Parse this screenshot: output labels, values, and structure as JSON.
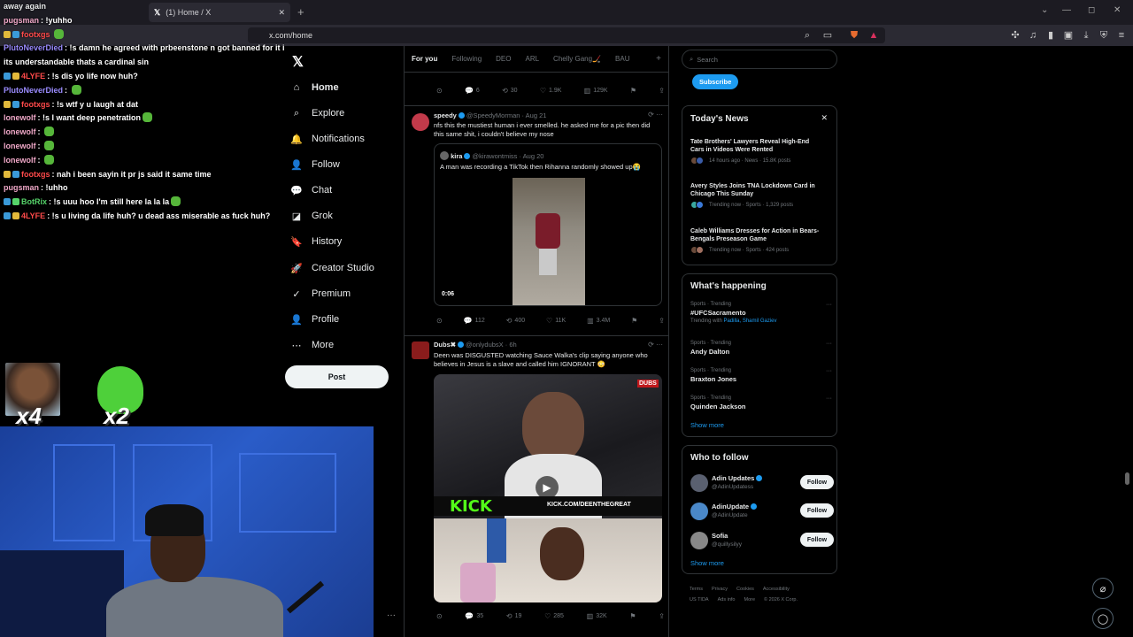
{
  "browser": {
    "tab_title": "(1) Home / X",
    "url": "x.com/home",
    "new_tab": "+",
    "win_min": "—",
    "win_max": "◻",
    "win_close": "✕",
    "chevron": "⌄"
  },
  "chat": {
    "messages": [
      {
        "user": "away again",
        "user_color": "#e7e9ea",
        "text": "",
        "badges": []
      },
      {
        "user": "pugsman",
        "user_color": "#f0a8c8",
        "text": ": !yuhho",
        "badges": []
      },
      {
        "user": "footxgs",
        "user_color": "#ff4a4a",
        "text": "",
        "badges": [
          "#e2b93b",
          "#3a9ad9"
        ],
        "emote": true
      },
      {
        "user": "PlutoNeverDied",
        "user_color": "#9b8cff",
        "text": ": !s damn he agreed with prbeenstone n got banned for it i mean",
        "badges": []
      },
      {
        "user": "",
        "user_color": "#e7e9ea",
        "text": "its understandable thats a cardinal sin",
        "badges": []
      },
      {
        "user": "4LYFE",
        "user_color": "#ff4a4a",
        "text": ": !s dis yo life now huh?",
        "badges": [
          "#3a9ad9",
          "#e2b93b"
        ]
      },
      {
        "user": "PlutoNeverDied",
        "user_color": "#9b8cff",
        "text": ": ",
        "badges": [],
        "emote": true
      },
      {
        "user": "footxgs",
        "user_color": "#ff4a4a",
        "text": ": !s wtf y u laugh at dat",
        "badges": [
          "#e2b93b",
          "#3a9ad9"
        ]
      },
      {
        "user": "lonewolf",
        "user_color": "#f0a8c8",
        "text": ": !s I want deep penetration",
        "badges": [],
        "emote": true
      },
      {
        "user": "lonewolf",
        "user_color": "#f0a8c8",
        "text": ": ",
        "badges": [],
        "emote": true
      },
      {
        "user": "lonewolf",
        "user_color": "#f0a8c8",
        "text": ": ",
        "badges": [],
        "emote": true
      },
      {
        "user": "lonewolf",
        "user_color": "#f0a8c8",
        "text": ": ",
        "badges": [],
        "emote": true
      },
      {
        "user": "footxgs",
        "user_color": "#ff4a4a",
        "text": ": nah i been sayin it pr js said it same time",
        "badges": [
          "#e2b93b",
          "#3a9ad9"
        ]
      },
      {
        "user": "pugsman",
        "user_color": "#f0a8c8",
        "text": ": !uhho",
        "badges": []
      },
      {
        "user": "BotRix",
        "user_color": "#56d46a",
        "text": ": !s uuu hoo I'm still here la la la",
        "badges": [
          "#3a9ad9",
          "#56d46a"
        ],
        "emote": true
      },
      {
        "user": "4LYFE",
        "user_color": "#ff4a4a",
        "text": ": !s u living da life huh? u dead ass miserable as fuck huh?",
        "badges": [
          "#3a9ad9",
          "#e2b93b"
        ]
      }
    ],
    "emote1_count": "x4",
    "emote2_count": "x2"
  },
  "nav": {
    "logo": "𝕏",
    "items": [
      {
        "label": "Home",
        "icon": "⌂",
        "icon_name": "home-icon"
      },
      {
        "label": "Explore",
        "icon": "⌕",
        "icon_name": "search-icon"
      },
      {
        "label": "Notifications",
        "icon": "🔔",
        "icon_name": "bell-icon"
      },
      {
        "label": "Follow",
        "icon": "👤",
        "icon_name": "follow-icon"
      },
      {
        "label": "Chat",
        "icon": "💬",
        "icon_name": "chat-icon"
      },
      {
        "label": "Grok",
        "icon": "◪",
        "icon_name": "grok-icon"
      },
      {
        "label": "History",
        "icon": "🔖",
        "icon_name": "bookmark-icon"
      },
      {
        "label": "Creator Studio",
        "icon": "🚀",
        "icon_name": "creator-icon"
      },
      {
        "label": "Premium",
        "icon": "✓",
        "icon_name": "premium-icon"
      },
      {
        "label": "Profile",
        "icon": "👤",
        "icon_name": "profile-icon"
      },
      {
        "label": "More",
        "icon": "⋯",
        "icon_name": "more-icon"
      }
    ],
    "post_label": "Post",
    "dots": "···"
  },
  "feed": {
    "tabs": [
      "For you",
      "Following",
      "DEO",
      "ARL",
      "Chelly Gang🏒",
      "BAU"
    ],
    "plus": "+",
    "actions1": {
      "replies": "6",
      "reposts": "30",
      "likes": "1.9K",
      "views": "129K"
    },
    "post2": {
      "name": "speedy",
      "handle": "@SpeedyMorman · Aug 21",
      "text": "nfs this the mustiest human i ever smelled. he asked me for a pic then did this same shit, i couldn't believe my nose",
      "quote_name": "kira",
      "quote_handle": "@kirawontmiss · Aug 20",
      "quote_text": "A man was recording a TikTok then Rihanna randomly showed up😭",
      "video_time": "0:06",
      "replies": "112",
      "reposts": "400",
      "likes": "11K",
      "views": "3.4M"
    },
    "post3": {
      "name": "Dubs✖",
      "handle": "@onlydubsX · 6h",
      "text": "Deen was DISGUSTED watching Sauce Walka's clip saying anyone who believes in Jesus is a slave and called him IGNORANT 😳",
      "brand": "DUBS",
      "kick": "KICK",
      "kick_url": "KICK.COM/DEENTHEGREAT",
      "replies": "35",
      "reposts": "19",
      "likes": "285",
      "views": "32K"
    }
  },
  "right": {
    "search_placeholder": "Search",
    "subscribe": "Subscribe",
    "news_title": "Today's News",
    "news": [
      {
        "headline": "Tate Brothers' Lawyers Reveal High-End Cars in Videos Were Rented",
        "meta": "14 hours ago · News · 15.8K posts"
      },
      {
        "headline": "Avery Styles Joins TNA Lockdown Card in Chicago This Sunday",
        "meta": "Trending now · Sports · 1,329 posts"
      },
      {
        "headline": "Caleb Williams Dresses for Action in Bears-Bengals Preseason Game",
        "meta": "Trending now · Sports · 424 posts"
      }
    ],
    "happening_title": "What's happening",
    "trends": [
      {
        "context": "Sports · Trending",
        "name": "#UFCSacramento",
        "with": "Trending with ",
        "with_links": "Padilla, Shamil Gaziev"
      },
      {
        "context": "Sports · Trending",
        "name": "Andy Dalton",
        "with": "",
        "with_links": ""
      },
      {
        "context": "Sports · Trending",
        "name": "Braxton Jones",
        "with": "",
        "with_links": ""
      },
      {
        "context": "Sports · Trending",
        "name": "Quinden Jackson",
        "with": "",
        "with_links": ""
      }
    ],
    "show_more": "Show more",
    "wtf_title": "Who to follow",
    "wtf": [
      {
        "name": "Adin Updates",
        "handle": "@AdinUpdatess",
        "verified": true,
        "button": "Follow"
      },
      {
        "name": "AdinUpdate",
        "handle": "@AdinUpdate",
        "verified": true,
        "button": "Follow"
      },
      {
        "name": "Sofia",
        "handle": "@quillysilyy",
        "verified": false,
        "button": "Follow"
      }
    ],
    "footer_line1": [
      "Terms",
      "Privacy",
      "Cookies",
      "Accessibility"
    ],
    "footer_line2": [
      "US TIDA",
      "Ads info",
      "More",
      "© 2026 X Corp."
    ]
  }
}
